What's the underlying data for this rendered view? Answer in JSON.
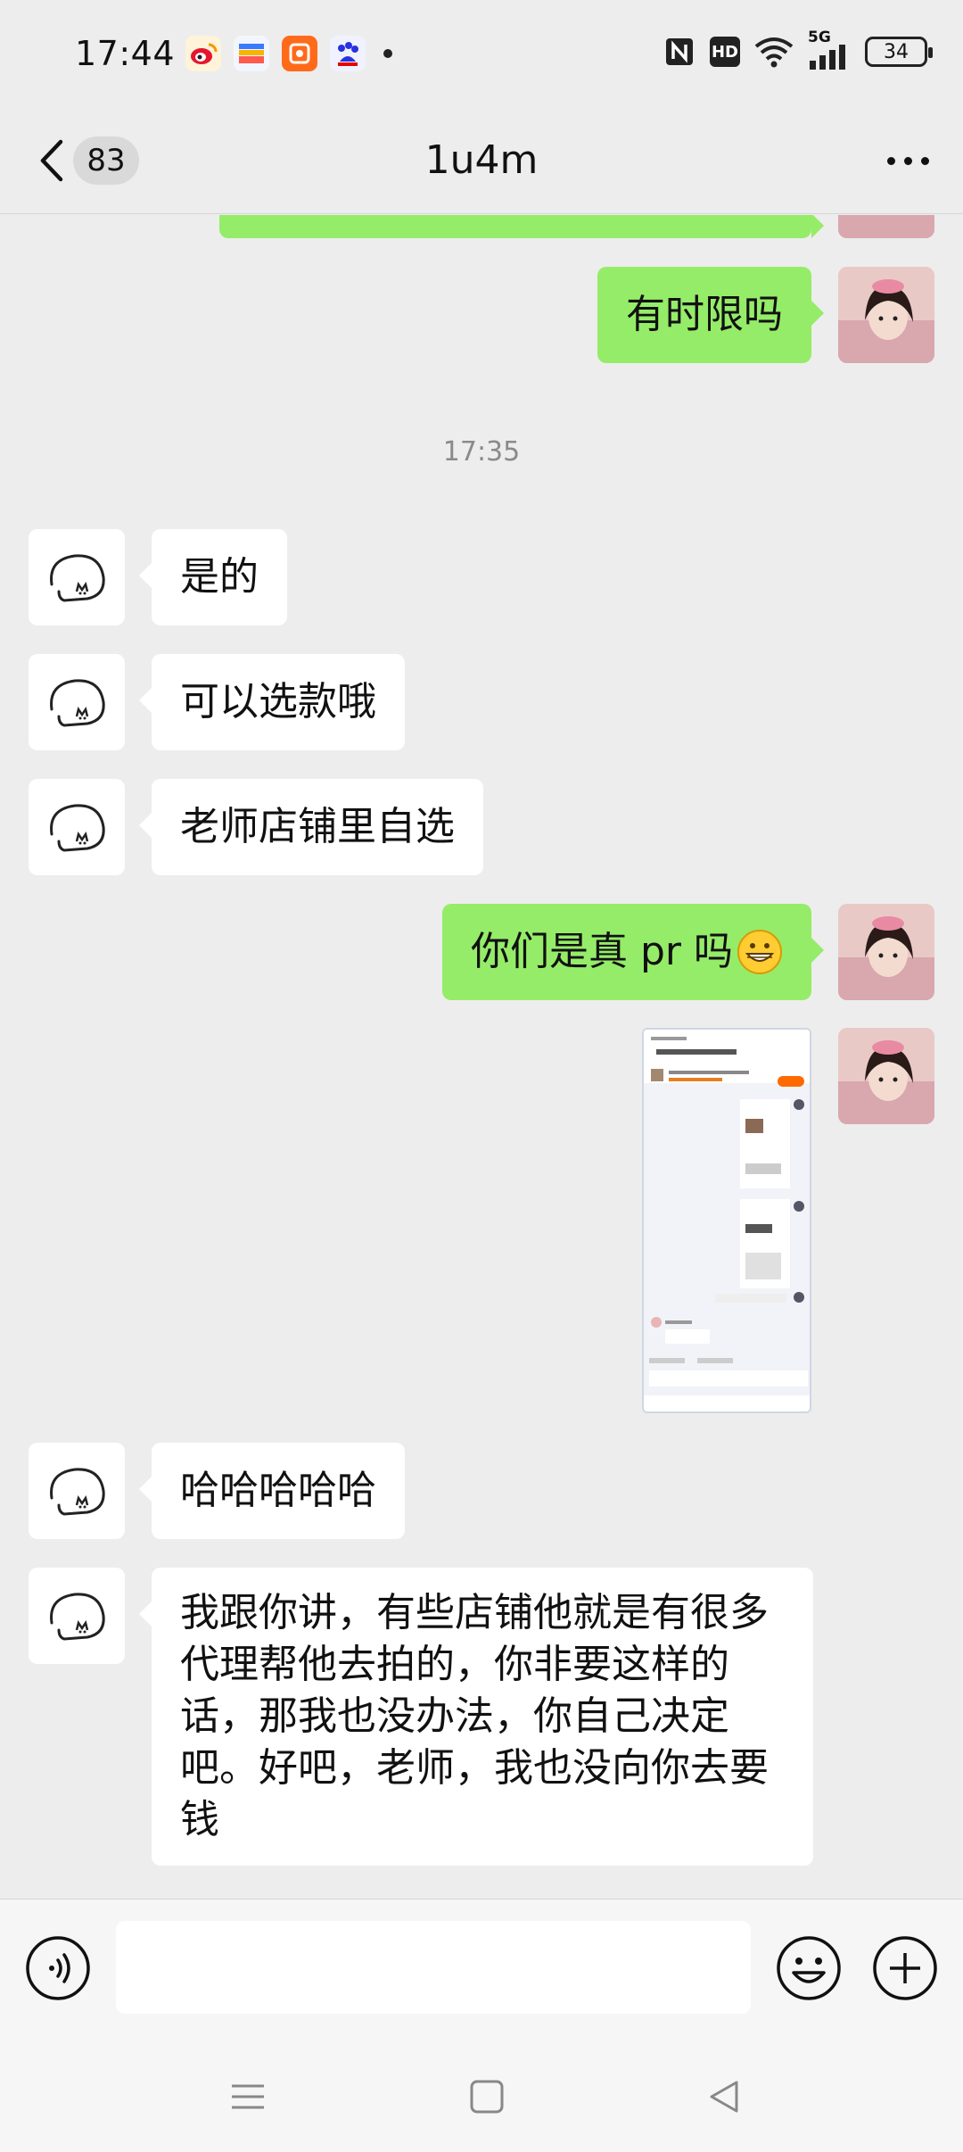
{
  "status_bar": {
    "time": "17:44",
    "notification_icons": [
      "weibo-icon",
      "wallet-icon",
      "app-icon",
      "baidu-icon"
    ],
    "system_icons": [
      "nfc-icon",
      "hd-icon",
      "wifi-icon",
      "signal-5g-icon",
      "battery-icon"
    ],
    "hd_label": "HD",
    "network_label": "5G",
    "battery_level": "34"
  },
  "nav": {
    "unread_count": "83",
    "title": "1u4m"
  },
  "messages": [
    {
      "type": "text",
      "from": "self",
      "text": "有时限吗"
    },
    {
      "type": "time",
      "text": "17:35"
    },
    {
      "type": "text",
      "from": "other",
      "text": "是的"
    },
    {
      "type": "text",
      "from": "other",
      "text": "可以选款哦"
    },
    {
      "type": "text",
      "from": "other",
      "text": "老师店铺里自选"
    },
    {
      "type": "text",
      "from": "self",
      "text": "你们是真 pr 吗"
    },
    {
      "type": "image",
      "from": "self"
    },
    {
      "type": "text",
      "from": "other",
      "text": "哈哈哈哈哈"
    },
    {
      "type": "text",
      "from": "other",
      "text": "我跟你讲，有些店铺他就是有很多代理帮他去拍的，你非要这样的话，那我也没办法，你自己决定吧。好吧，老师，我也没向你去要钱"
    }
  ],
  "input": {
    "placeholder": ""
  },
  "colors": {
    "background": "#ededed",
    "self_bubble": "#95ec69",
    "other_bubble": "#ffffff"
  }
}
